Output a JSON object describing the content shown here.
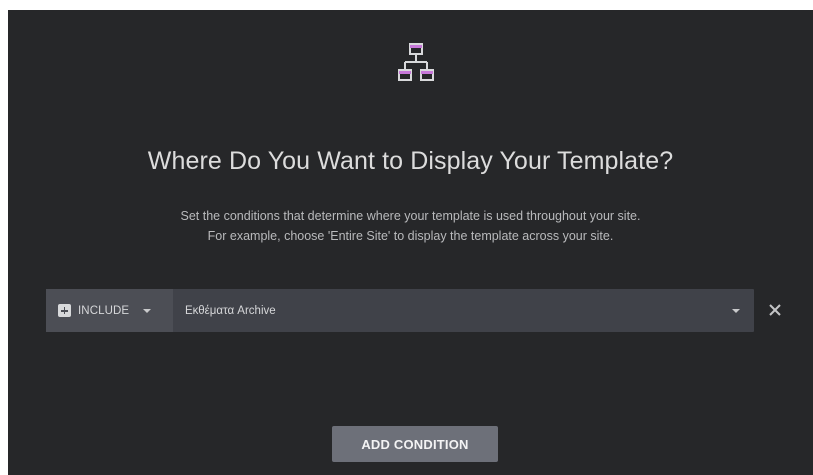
{
  "icons": {
    "hero": "sitemap-icon",
    "include": "plus-square-icon",
    "dropdown": "chevron-down-icon",
    "remove": "close-icon"
  },
  "colors": {
    "background": "#262729",
    "accent": "#c778d9",
    "text": "#dcdcdc",
    "button": "#6d7079"
  },
  "header": {
    "title": "Where Do You Want to Display Your Template?",
    "description_line1": "Set the conditions that determine where your template is used throughout your site.",
    "description_line2": "For example, choose 'Entire Site' to display the template across your site."
  },
  "condition": {
    "type_label": "INCLUDE",
    "value_label": "Εκθέματα Archive"
  },
  "actions": {
    "add_condition_label": "ADD CONDITION"
  }
}
